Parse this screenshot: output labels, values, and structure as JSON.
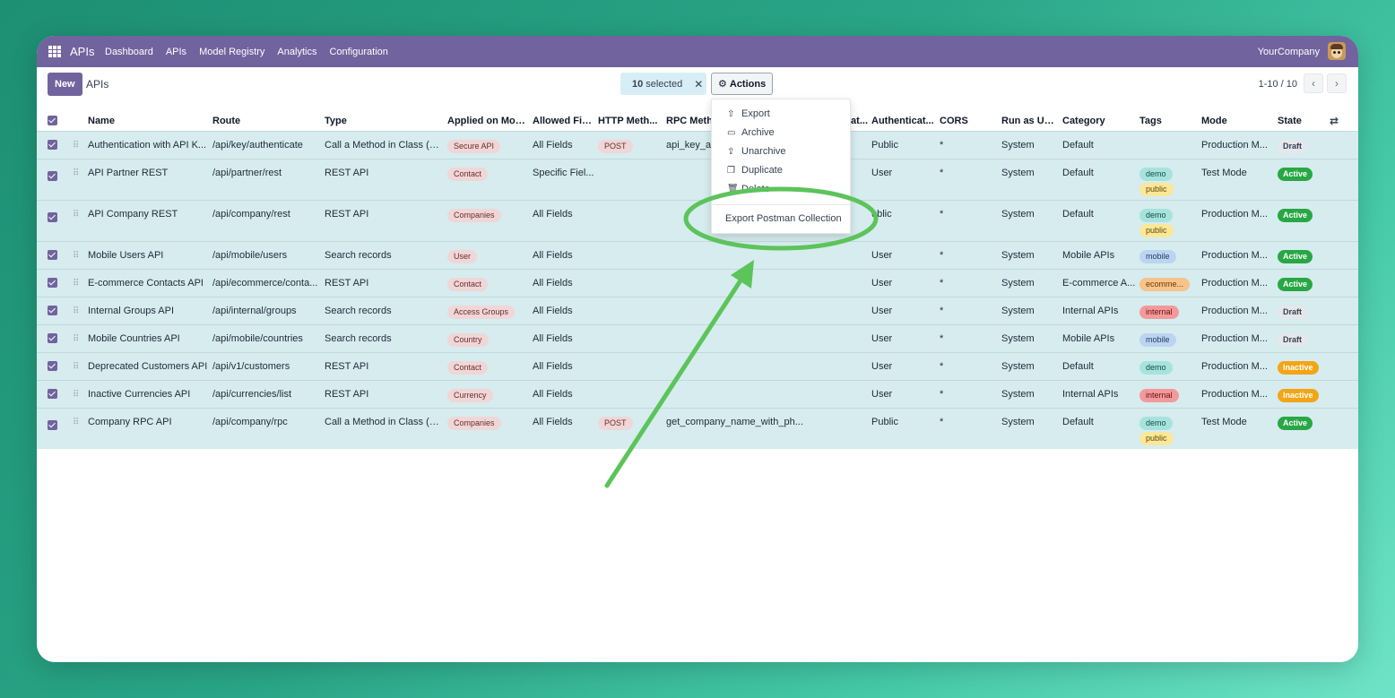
{
  "navbar": {
    "brand": "APIs",
    "menu": [
      "Dashboard",
      "APIs",
      "Model Registry",
      "Analytics",
      "Configuration"
    ],
    "company": "YourCompany"
  },
  "control": {
    "new_label": "New",
    "title": "APIs",
    "selected_count": "10",
    "selected_label": "selected",
    "actions_label": "Actions",
    "pager": "1-10 / 10"
  },
  "columns": [
    "Name",
    "Route",
    "Type",
    "Applied on Mod...",
    "Allowed Fie...",
    "HTTP Meth...",
    "RPC Metho",
    "Authenticat...",
    "Authenticat...",
    "CORS",
    "Run as User",
    "Category",
    "Tags",
    "Mode",
    "State"
  ],
  "rows": [
    {
      "name": "Authentication with API K...",
      "route": "/api/key/authenticate",
      "type": "Call a Method in Class (R...",
      "model": "Secure API",
      "fields": "All Fields",
      "http": "POST",
      "rpc": "api_key_au",
      "auth": "Public",
      "cors": "*",
      "user": "System",
      "category": "Default",
      "tags": [],
      "mode": "Production M...",
      "state": "Draft"
    },
    {
      "name": "API Partner REST",
      "route": "/api/partner/rest",
      "type": "REST API",
      "model": "Contact",
      "fields": "Specific Fiel...",
      "http": "",
      "rpc": "",
      "auth": "User",
      "cors": "*",
      "user": "System",
      "category": "Default",
      "tags": [
        "demo",
        "public"
      ],
      "mode": "Test Mode",
      "state": "Active"
    },
    {
      "name": "API Company REST",
      "route": "/api/company/rest",
      "type": "REST API",
      "model": "Companies",
      "fields": "All Fields",
      "http": "",
      "rpc": "",
      "auth": "ublic",
      "cors": "*",
      "user": "System",
      "category": "Default",
      "tags": [
        "demo",
        "public"
      ],
      "mode": "Production M...",
      "state": "Active"
    },
    {
      "name": "Mobile Users API",
      "route": "/api/mobile/users",
      "type": "Search records",
      "model": "User",
      "fields": "All Fields",
      "http": "",
      "rpc": "",
      "auth": "User",
      "cors": "*",
      "user": "System",
      "category": "Mobile APIs",
      "tags": [
        "mobile"
      ],
      "mode": "Production M...",
      "state": "Active"
    },
    {
      "name": "E-commerce Contacts API",
      "route": "/api/ecommerce/conta...",
      "type": "REST API",
      "model": "Contact",
      "fields": "All Fields",
      "http": "",
      "rpc": "",
      "auth": "User",
      "cors": "*",
      "user": "System",
      "category": "E-commerce A...",
      "tags": [
        "ecomme..."
      ],
      "mode": "Production M...",
      "state": "Active"
    },
    {
      "name": "Internal Groups API",
      "route": "/api/internal/groups",
      "type": "Search records",
      "model": "Access Groups",
      "fields": "All Fields",
      "http": "",
      "rpc": "",
      "auth": "User",
      "cors": "*",
      "user": "System",
      "category": "Internal APIs",
      "tags": [
        "internal"
      ],
      "mode": "Production M...",
      "state": "Draft"
    },
    {
      "name": "Mobile Countries API",
      "route": "/api/mobile/countries",
      "type": "Search records",
      "model": "Country",
      "fields": "All Fields",
      "http": "",
      "rpc": "",
      "auth": "User",
      "cors": "*",
      "user": "System",
      "category": "Mobile APIs",
      "tags": [
        "mobile"
      ],
      "mode": "Production M...",
      "state": "Draft"
    },
    {
      "name": "Deprecated Customers API",
      "route": "/api/v1/customers",
      "type": "REST API",
      "model": "Contact",
      "fields": "All Fields",
      "http": "",
      "rpc": "",
      "auth": "User",
      "cors": "*",
      "user": "System",
      "category": "Default",
      "tags": [
        "demo"
      ],
      "mode": "Production M...",
      "state": "Inactive"
    },
    {
      "name": "Inactive Currencies API",
      "route": "/api/currencies/list",
      "type": "REST API",
      "model": "Currency",
      "fields": "All Fields",
      "http": "",
      "rpc": "",
      "auth": "User",
      "cors": "*",
      "user": "System",
      "category": "Internal APIs",
      "tags": [
        "internal"
      ],
      "mode": "Production M...",
      "state": "Inactive"
    },
    {
      "name": "Company RPC API",
      "route": "/api/company/rpc",
      "type": "Call a Method in Class (R...",
      "model": "Companies",
      "fields": "All Fields",
      "http": "POST",
      "rpc": "get_company_name_with_ph...",
      "auth": "Public",
      "cors": "*",
      "user": "System",
      "category": "Default",
      "tags": [
        "demo",
        "public"
      ],
      "mode": "Test Mode",
      "state": "Active"
    }
  ],
  "actions_menu": {
    "export": "Export",
    "archive": "Archive",
    "unarchive": "Unarchive",
    "duplicate": "Duplicate",
    "delete": "Delete",
    "postman": "Export Postman Collection"
  },
  "colors": {
    "brand": "#71639e",
    "row_selected": "#d6ecef",
    "annotation": "#5cc45a",
    "active": "#28a745",
    "inactive": "#f2a516"
  }
}
